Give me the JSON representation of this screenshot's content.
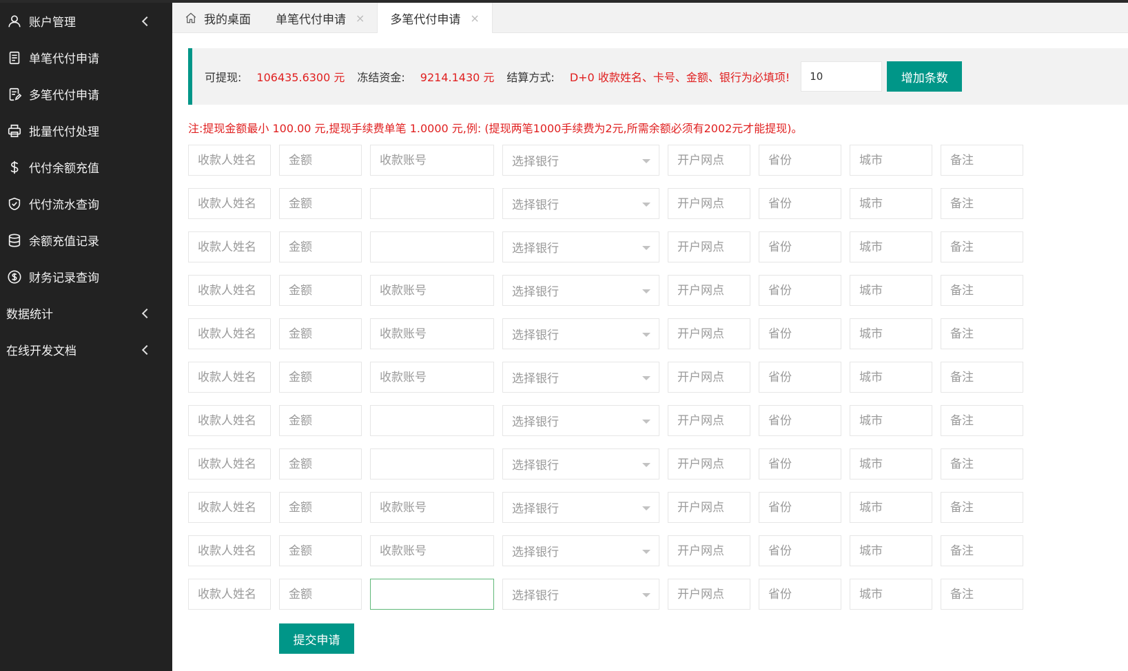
{
  "sidebar": {
    "items": [
      {
        "label": "账户管理",
        "icon": "user-icon",
        "arrow": true
      },
      {
        "label": "单笔代付申请",
        "icon": "document-icon",
        "arrow": false
      },
      {
        "label": "多笔代付申请",
        "icon": "edit-document-icon",
        "arrow": false
      },
      {
        "label": "批量代付处理",
        "icon": "printer-icon",
        "arrow": false
      },
      {
        "label": "代付余额充值",
        "icon": "dollar-icon",
        "arrow": false
      },
      {
        "label": "代付流水查询",
        "icon": "shield-check-icon",
        "arrow": false
      },
      {
        "label": "余额充值记录",
        "icon": "database-icon",
        "arrow": false
      },
      {
        "label": "财务记录查询",
        "icon": "coin-icon",
        "arrow": false
      },
      {
        "label": "数据统计",
        "icon": "",
        "arrow": true
      },
      {
        "label": "在线开发文档",
        "icon": "",
        "arrow": true
      }
    ]
  },
  "tabs": [
    {
      "label": "我的桌面",
      "home": true,
      "closable": false,
      "active": false
    },
    {
      "label": "单笔代付申请",
      "home": false,
      "closable": true,
      "active": false
    },
    {
      "label": "多笔代付申请",
      "home": false,
      "closable": true,
      "active": true
    }
  ],
  "tab_close_glyph": "×",
  "info": {
    "withdrawable_label": "可提现:",
    "withdrawable_value": "106435.6300 元",
    "frozen_label": "冻结资金:",
    "frozen_value": "9214.1430 元",
    "settlement_label": "结算方式:",
    "settlement_value": "D+0 收款姓名、卡号、金额、银行为必填项!",
    "count_value": "10",
    "add_button": "增加条数"
  },
  "note": "注:提现金额最小 100.00 元,提现手续费单笔 1.0000 元,例: (提现两笔1000手续费为2元,所需余额必须有2002元才能提现)。",
  "form": {
    "placeholders": {
      "name": "收款人姓名",
      "amount": "金额",
      "account": "收款账号",
      "bank": "选择银行",
      "branch": "开户网点",
      "province": "省份",
      "city": "城市",
      "remark": "备注"
    },
    "row_count": 11,
    "rows_without_account_placeholder": [
      1,
      2,
      6,
      7,
      10
    ],
    "focused_account_row": 10
  },
  "submit_button": "提交申请"
}
